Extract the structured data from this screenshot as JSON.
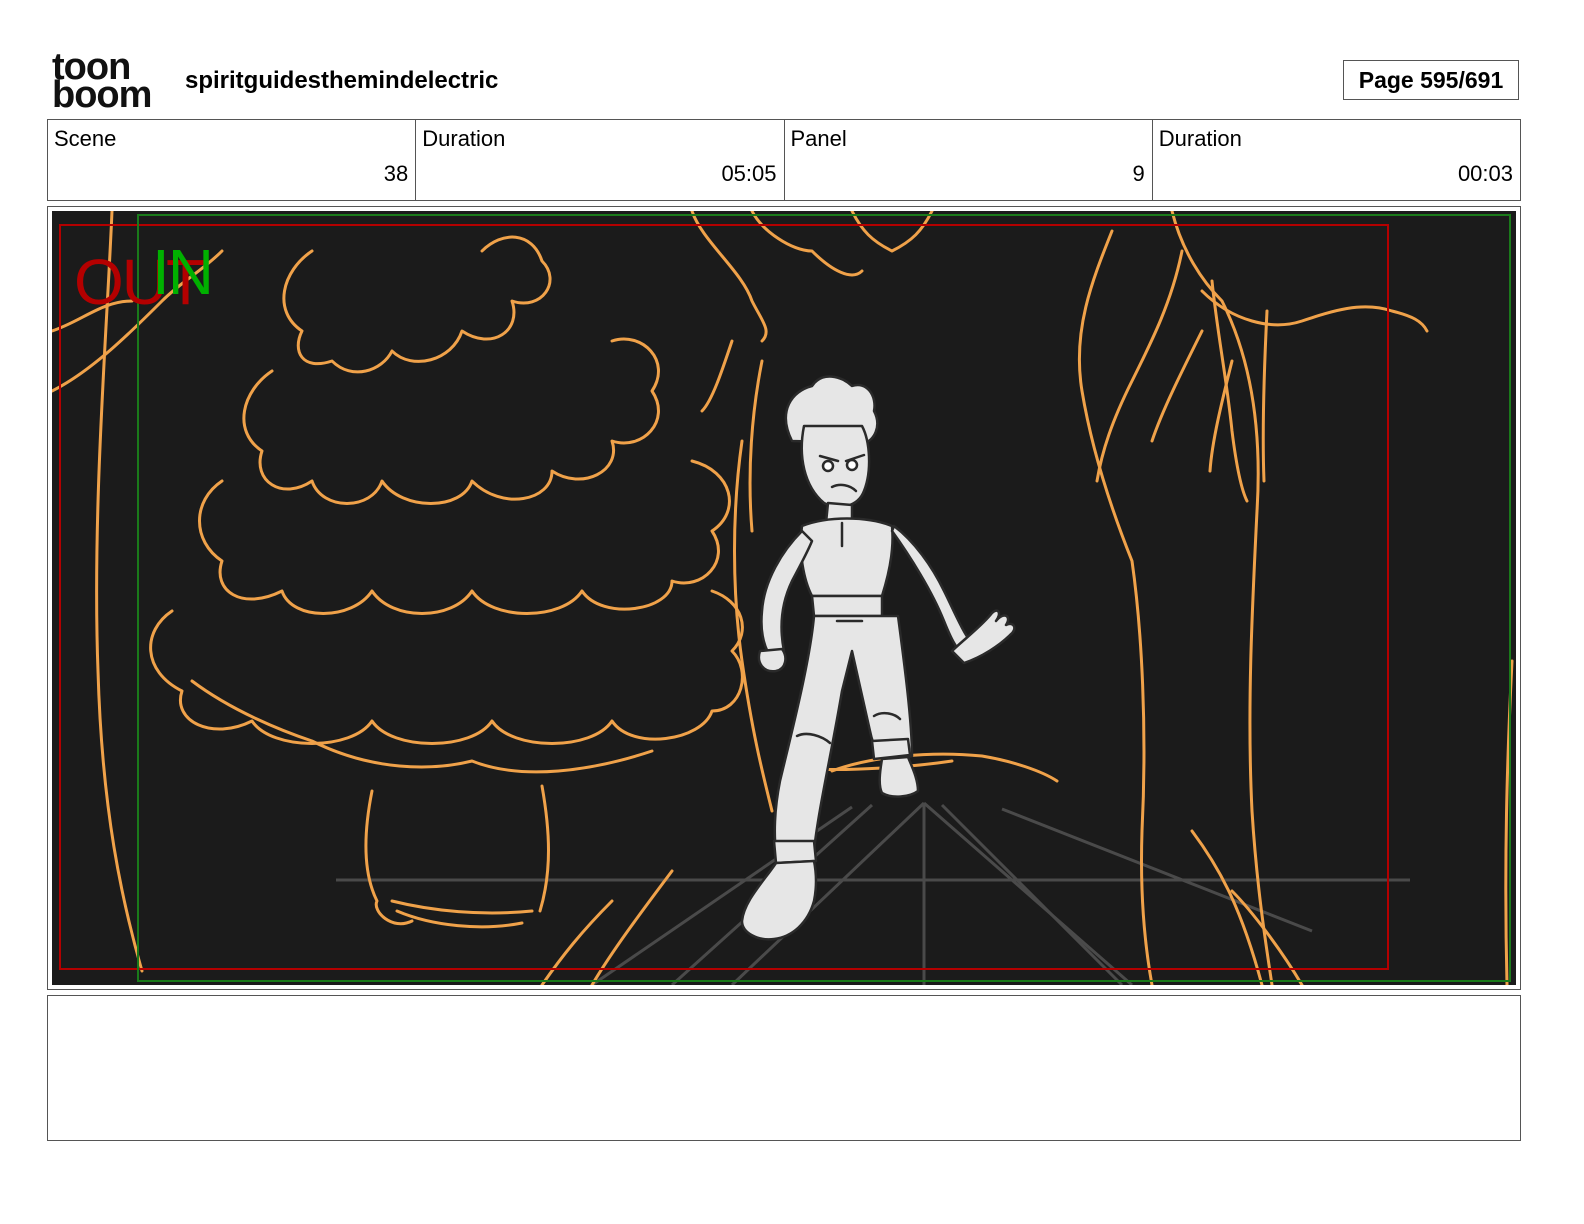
{
  "header": {
    "logo_top": "toon",
    "logo_bottom": "boom",
    "project_title": "spiritguidesthemindelectric",
    "page_indicator": "Page 595/691"
  },
  "info": {
    "scene_label": "Scene",
    "scene_value": "38",
    "scene_duration_label": "Duration",
    "scene_duration_value": "05:05",
    "panel_label": "Panel",
    "panel_value": "9",
    "panel_duration_label": "Duration",
    "panel_duration_value": "00:03"
  },
  "panel": {
    "out_marker": "OUT",
    "in_marker": "IN",
    "colors": {
      "background": "#1b1b1b",
      "sketch_orange": "#f0a24a",
      "character_fill": "#e6e6e6",
      "safe_frame_red": "#b40000",
      "safe_frame_green": "#1a7a1a"
    }
  },
  "notes": {
    "text": ""
  }
}
